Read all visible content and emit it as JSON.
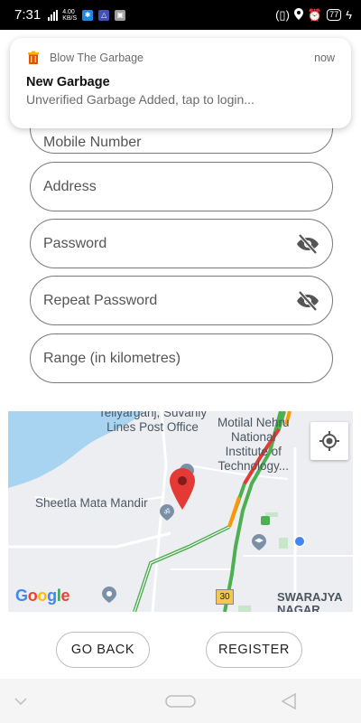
{
  "status_bar": {
    "time": "7:31",
    "net_speed_top": "4.00",
    "net_speed_bottom": "KB/S",
    "battery": "77"
  },
  "notification": {
    "app_name": "Blow The Garbage",
    "time": "now",
    "title": "New Garbage",
    "text": "Unverified Garbage Added, tap to login..."
  },
  "form": {
    "mobile_placeholder": "Mobile Number",
    "address_placeholder": "Address",
    "password_placeholder": "Password",
    "repeat_password_placeholder": "Repeat Password",
    "range_placeholder": "Range (in kilometres)"
  },
  "map": {
    "label_post_office_line1": "Teliyarganj, Suvaniy",
    "label_post_office_line2": "Lines Post Office",
    "label_institute_line1": "Motilal Nehru",
    "label_institute_line2": "National",
    "label_institute_line3": "Institute of",
    "label_institute_line4": "Technology...",
    "label_mandir": "Sheetla Mata Mandir",
    "label_swarajya_line1": "SWARAJYA",
    "label_swarajya_line2": "NAGAR",
    "road_shield": "30",
    "google_logo": "Google",
    "marker_color": "#e53935",
    "water_color": "#a8d4f2"
  },
  "buttons": {
    "go_back": "GO BACK",
    "register": "REGISTER"
  }
}
